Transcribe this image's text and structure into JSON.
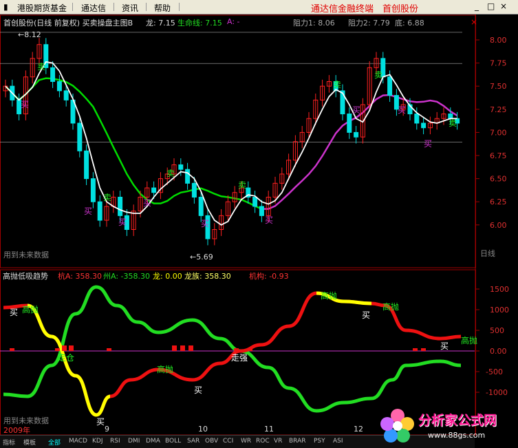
{
  "menubar": {
    "items": [
      "港股期货基金",
      "通达信",
      "资讯",
      "帮助"
    ],
    "brand_left": "通达信金融终端",
    "brand_right": "首创股份",
    "window_buttons": [
      "_",
      "□",
      "×"
    ]
  },
  "main_panel": {
    "title": "首创股份(日线 前复权) 买卖操盘主图B",
    "long_label": "龙: 7.15",
    "life_label": "生命线: 7.15",
    "a_label": "A: -",
    "resist1": "阻力1: 8.06",
    "resist2": "阻力2: 7.79",
    "bottom": "底: 6.88",
    "high_marker": "8.12",
    "low_marker": "5.69",
    "future_note": "用到未来数据",
    "price_ticks": [
      "8.00",
      "7.75",
      "7.50",
      "7.25",
      "7.00",
      "6.75",
      "6.50",
      "6.25",
      "6.00"
    ],
    "side_label": "日线"
  },
  "sub_panel": {
    "title": "高抛低吸趋势",
    "hang": "杭A: 358.30",
    "zhou": "州A: -358.30",
    "long": "龙: 0.00",
    "clan": "龙族: 358.30",
    "inst": "机构: -0.93",
    "future_note": "用到未来数据",
    "ticks": [
      "1500",
      "1000",
      "500",
      "0.00",
      "-500",
      "-1000"
    ]
  },
  "signals": {
    "buy": "买",
    "sell": "卖",
    "high_sell": "高抛",
    "stop": "定仓",
    "strong": "走强"
  },
  "time_axis": {
    "labels": [
      "2009年",
      "9",
      "10",
      "11",
      "12"
    ]
  },
  "tabs": [
    "指标",
    "模板",
    "全部",
    "MACD",
    "KDJ",
    "RSI",
    "DMI",
    "DMA",
    "BOLL",
    "SAR",
    "OBV",
    "CCI",
    "WR",
    "ROC",
    "VR",
    "BRAR",
    "PSY",
    "ASI"
  ],
  "watermark": {
    "title": "分析家公式网",
    "url": "www.88gs.com"
  },
  "colors": {
    "up": "#ff2020",
    "down": "#00e0e0",
    "grid": "#800000",
    "life": "#00dd00",
    "magenta": "#cc33cc",
    "yellow": "#ffff00",
    "green": "#22dd22",
    "red": "#ee1111"
  }
}
